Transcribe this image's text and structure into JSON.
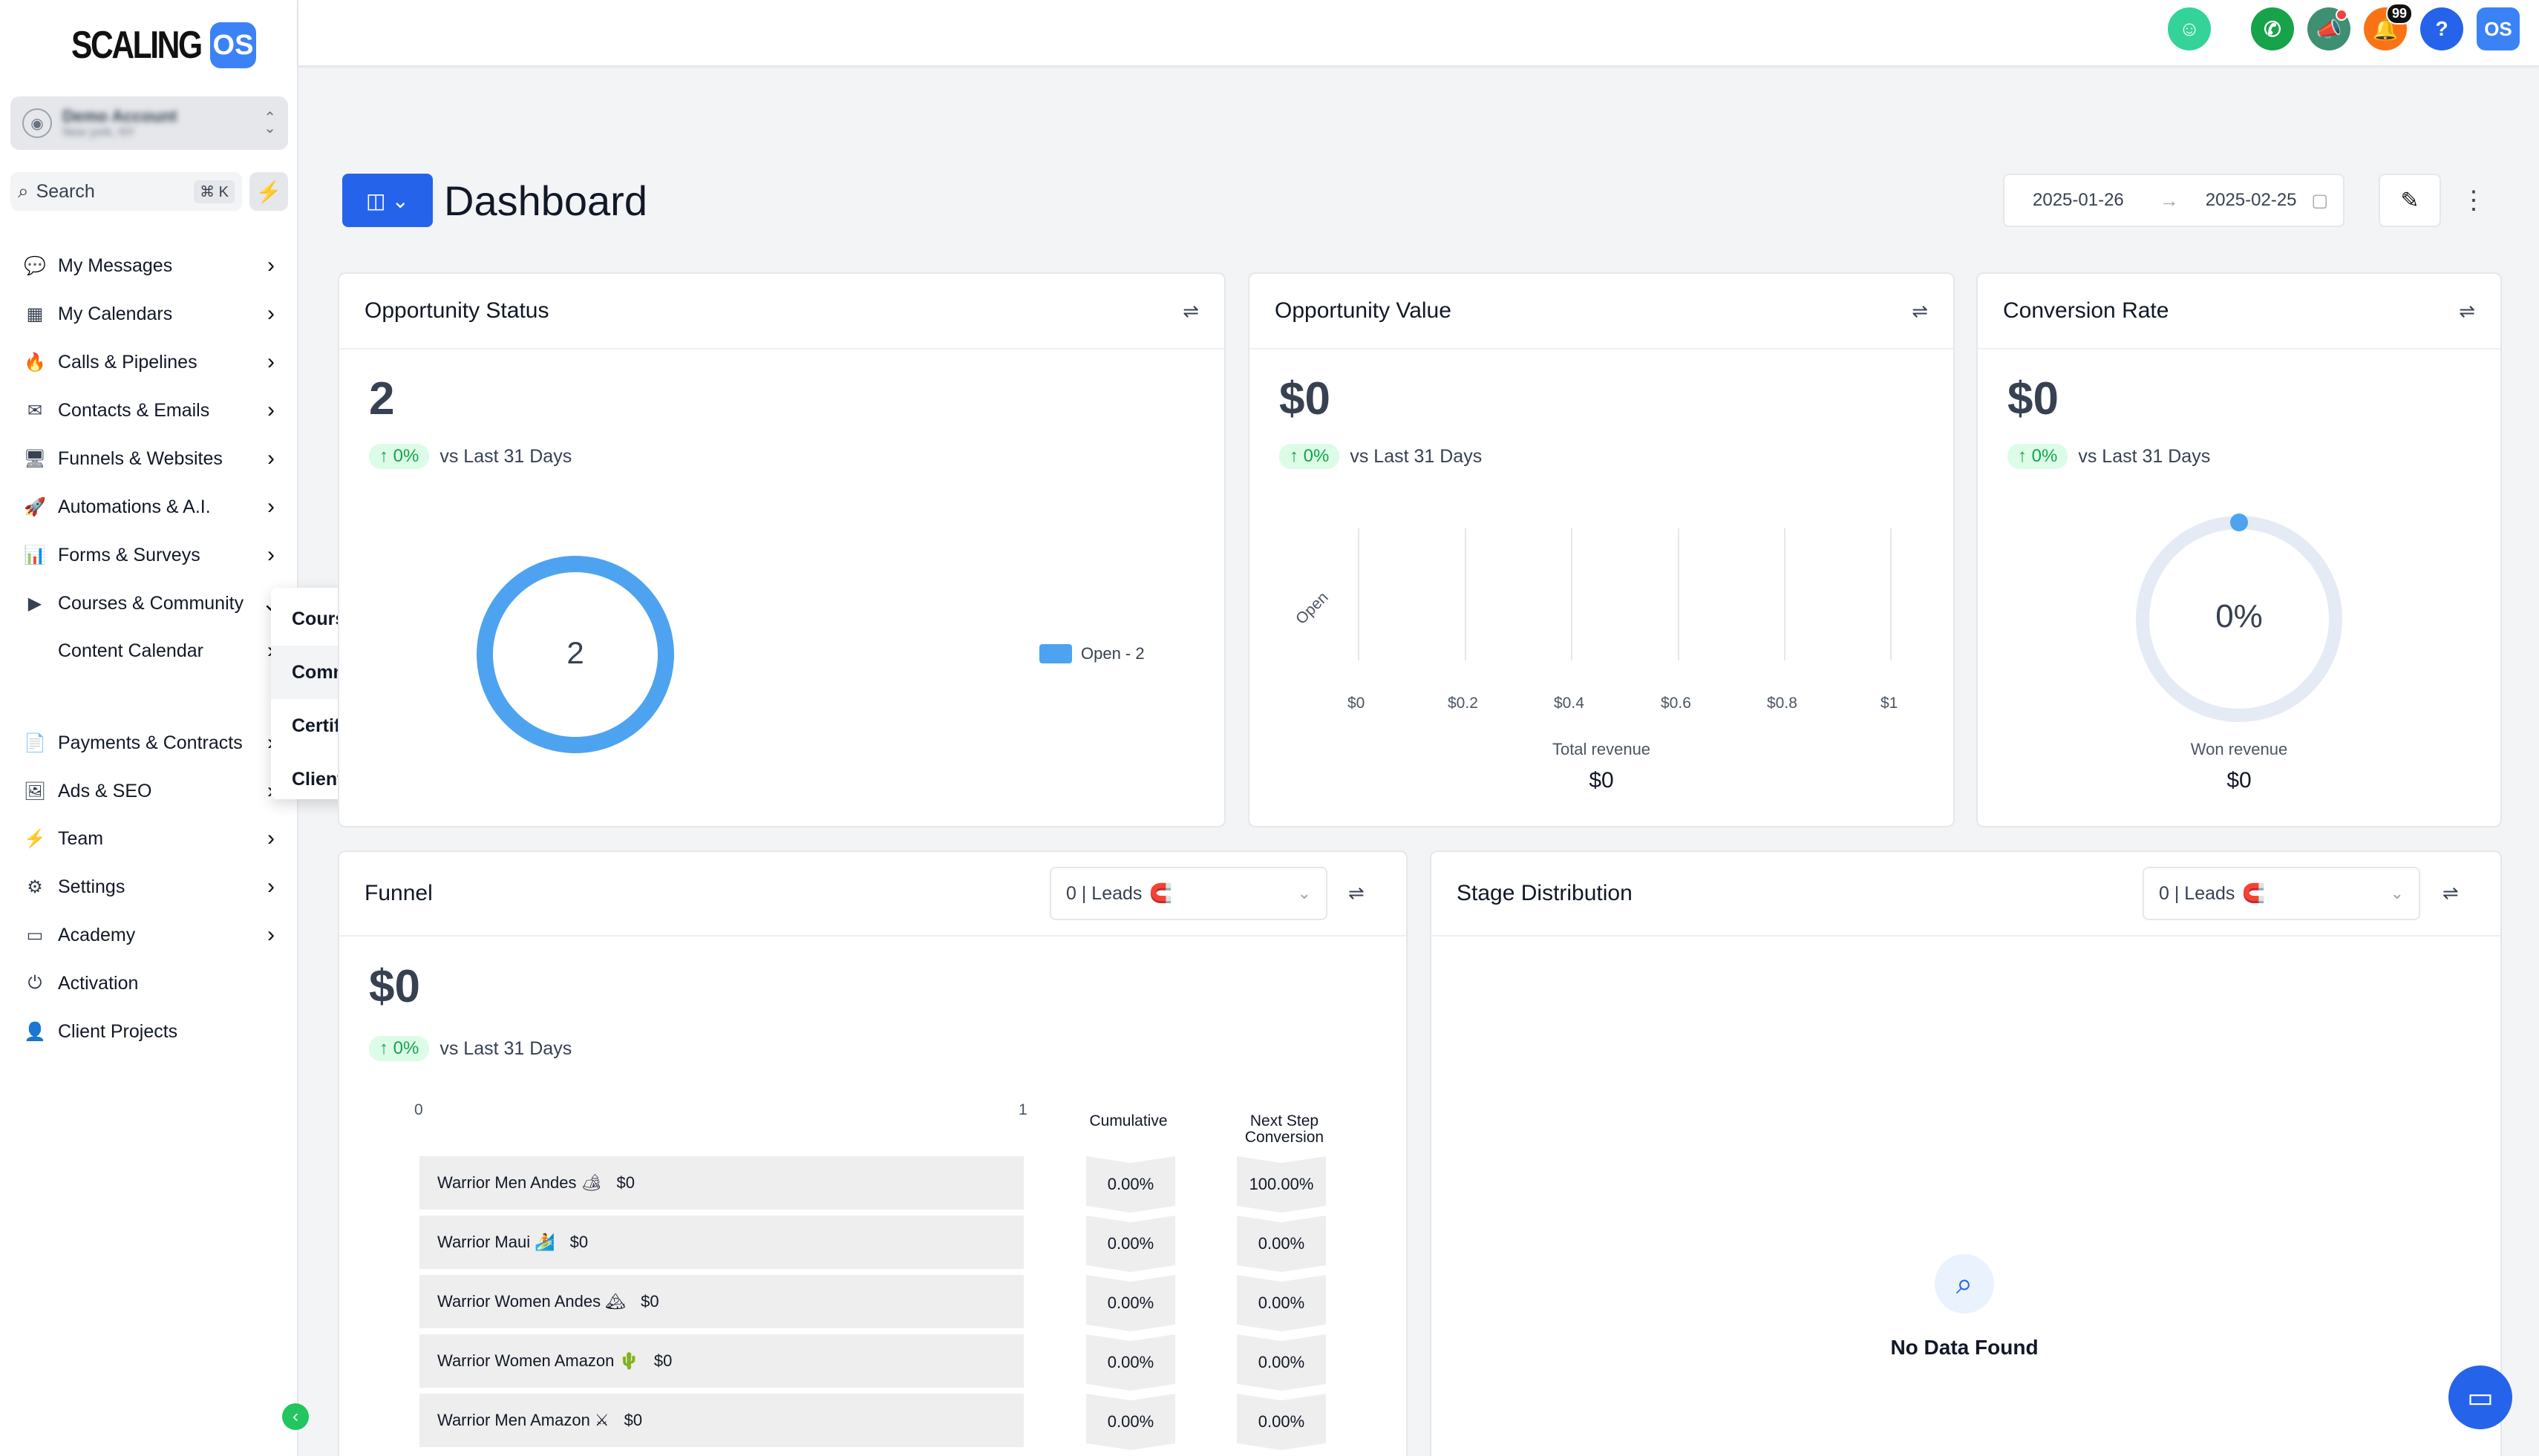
{
  "brand": {
    "word": "SCALING",
    "badge": "OS"
  },
  "account": {
    "name": "Demo Account",
    "location": "New york, NY"
  },
  "search": {
    "label": "Search",
    "shortcut": "⌘ K"
  },
  "nav": [
    {
      "label": "My Messages",
      "icon": "chat-icon",
      "glyph": "💬"
    },
    {
      "label": "My Calendars",
      "icon": "calendar-icon",
      "glyph": "▦"
    },
    {
      "label": "Calls & Pipelines",
      "icon": "flame-icon",
      "glyph": "🔥"
    },
    {
      "label": "Contacts & Emails",
      "icon": "mail-icon",
      "glyph": "✉"
    },
    {
      "label": "Funnels & Websites",
      "icon": "monitor-icon",
      "glyph": "🖥"
    },
    {
      "label": "Automations & A.I.",
      "icon": "rocket-icon",
      "glyph": "🚀"
    },
    {
      "label": "Forms & Surveys",
      "icon": "chart-icon",
      "glyph": "📊"
    },
    {
      "label": "Courses & Community",
      "icon": "video-icon",
      "glyph": "▶"
    },
    {
      "label": "Content Calendar",
      "icon": "apple-icon",
      "glyph": ""
    },
    {
      "label": "Payments & Contracts",
      "icon": "document-icon",
      "glyph": "📄"
    },
    {
      "label": "Ads & SEO",
      "icon": "ad-icon",
      "glyph": "🖼"
    },
    {
      "label": "Team",
      "icon": "bolt-icon",
      "glyph": "⚡"
    },
    {
      "label": "Settings",
      "icon": "gear-icon",
      "glyph": "⚙"
    },
    {
      "label": "Academy",
      "icon": "card-icon",
      "glyph": "▭"
    },
    {
      "label": "Activation",
      "icon": "power-icon",
      "glyph": "⏻"
    },
    {
      "label": "Client Projects",
      "icon": "user-icon",
      "glyph": "👤"
    }
  ],
  "flyout": [
    "Courses",
    "Communities",
    "Certificates",
    "Clients Portal"
  ],
  "topbar": {
    "notifications_count": "99"
  },
  "page": {
    "title": "Dashboard",
    "date_from": "2025-01-26",
    "date_to": "2025-02-25"
  },
  "opportunity_status": {
    "title": "Opportunity Status",
    "value": "2",
    "delta": "↑ 0%",
    "compare": "vs Last 31 Days",
    "donut_center": "2",
    "legend": "Open - 2"
  },
  "opportunity_value": {
    "title": "Opportunity Value",
    "value": "$0",
    "delta": "↑ 0%",
    "compare": "vs Last 31 Days",
    "y_label": "Open",
    "x_ticks": [
      "$0",
      "$0.2",
      "$0.4",
      "$0.6",
      "$0.8",
      "$1"
    ],
    "footer_label": "Total revenue",
    "footer_value": "$0"
  },
  "conversion_rate": {
    "title": "Conversion Rate",
    "value": "$0",
    "delta": "↑ 0%",
    "compare": "vs Last 31 Days",
    "gauge_text": "0%",
    "gauge_value": 0,
    "footer_label": "Won revenue",
    "footer_value": "$0"
  },
  "funnel": {
    "title": "Funnel",
    "select": "0 | Leads",
    "value": "$0",
    "delta": "↑ 0%",
    "compare": "vs Last 31 Days",
    "axis_min": "0",
    "axis_max": "1",
    "col_cumulative": "Cumulative",
    "col_next_1": "Next Step",
    "col_next_2": "Conversion",
    "rows": [
      {
        "name": "Warrior Men Andes 🏕",
        "value": "$0",
        "cumulative": "0.00%",
        "next": "100.00%"
      },
      {
        "name": "Warrior Maui 🏄",
        "value": "$0",
        "cumulative": "0.00%",
        "next": "0.00%"
      },
      {
        "name": "Warrior Women Andes 🏔",
        "value": "$0",
        "cumulative": "0.00%",
        "next": "0.00%"
      },
      {
        "name": "Warrior Women Amazon 🌵",
        "value": "$0",
        "cumulative": "0.00%",
        "next": "0.00%"
      },
      {
        "name": "Warrior Men Amazon ⚔",
        "value": "$0",
        "cumulative": "0.00%",
        "next": "0.00%"
      }
    ]
  },
  "stage_distribution": {
    "title": "Stage Distribution",
    "select": "0 | Leads",
    "empty": "No Data Found"
  },
  "colors": {
    "primary": "#2563eb",
    "accent_green": "#22c55e",
    "donut": "#4da3f0"
  }
}
